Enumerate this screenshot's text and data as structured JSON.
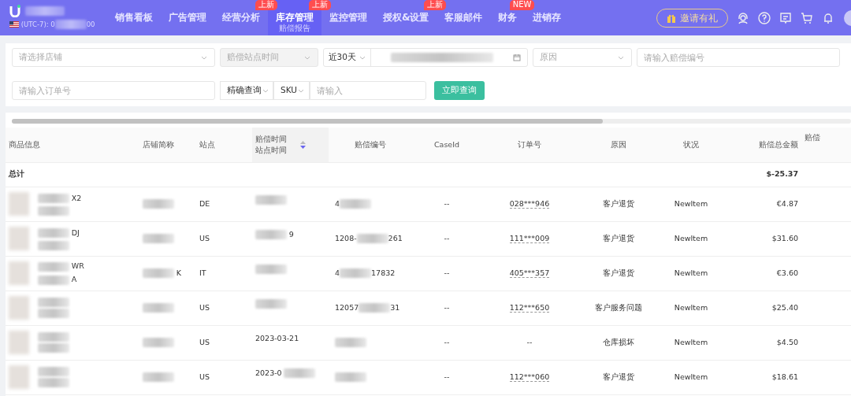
{
  "header": {
    "timezone": [
      {
        "text": "(UTC-7): 0"
      },
      {
        "redacted": true
      },
      {
        "text": "00"
      }
    ],
    "nav": [
      {
        "label": "销售看板",
        "selected": false
      },
      {
        "label": "广告管理",
        "selected": false
      },
      {
        "label": "经营分析",
        "selected": false,
        "badge": "上新"
      },
      {
        "label": "库存管理",
        "selected": true,
        "badge": "上新",
        "sub": "赔偿报告"
      },
      {
        "label": "监控管理",
        "selected": false
      },
      {
        "label": "授权&设置",
        "selected": false,
        "badge": "上新"
      },
      {
        "label": "客服邮件",
        "selected": false
      },
      {
        "label": "财务",
        "selected": false,
        "badge": "NEW"
      },
      {
        "label": "进销存",
        "selected": false
      }
    ],
    "invite_button": "邀请有礼"
  },
  "filters": [
    [
      {
        "kind": "select",
        "placeholder": "请选择店铺",
        "disabled": false
      },
      {
        "kind": "select",
        "placeholder": "赔偿站点时间",
        "disabled": true
      },
      {
        "kind": "range",
        "value": "近30天",
        "disabled": false
      },
      {
        "kind": "select",
        "placeholder": "原因",
        "disabled": false
      },
      {
        "kind": "input",
        "placeholder": "请输入赔偿编号",
        "disabled": false
      }
    ],
    [
      {
        "kind": "input",
        "placeholder": "请输入订单号",
        "disabled": false
      },
      {
        "kind": "select",
        "value": "精确查询",
        "disabled": false
      },
      {
        "kind": "select",
        "value": "SKU",
        "disabled": false
      },
      {
        "kind": "input",
        "placeholder": "请输入",
        "disabled": false
      },
      {
        "kind": "button",
        "label": "立即查询",
        "disabled": false
      }
    ]
  ],
  "table": {
    "columns": [
      {
        "lines": [
          "商品信息"
        ],
        "sortable": false
      },
      {
        "lines": [
          "店铺简称"
        ],
        "sortable": false
      },
      {
        "lines": [
          "站点"
        ],
        "sortable": false
      },
      {
        "lines": [
          "赔偿时间",
          "站点时间"
        ],
        "sortable": true
      },
      {
        "lines": [
          "赔偿编号"
        ],
        "sortable": false
      },
      {
        "lines": [
          "CaseId"
        ],
        "sortable": false
      },
      {
        "lines": [
          "订单号"
        ],
        "sortable": false
      },
      {
        "lines": [
          "原因"
        ],
        "sortable": false
      },
      {
        "lines": [
          "状况"
        ],
        "sortable": false
      },
      {
        "lines": [
          "赔偿总金额"
        ],
        "sortable": false
      },
      {
        "lines": [
          "赔偿"
        ],
        "sortable": false
      }
    ],
    "total": {
      "label": "总计",
      "amount": "$-25.37"
    },
    "rows": [
      {
        "product": [
          [
            {
              "redacted": true
            },
            {
              "text": "X2"
            }
          ],
          [
            {
              "redacted": true
            }
          ]
        ],
        "shop": [
          {
            "redacted": true
          }
        ],
        "site": "DE",
        "date": [
          {
            "redacted": true
          }
        ],
        "claim": [
          {
            "text": "4"
          },
          {
            "redacted": true
          }
        ],
        "case_id": "--",
        "order": "028***946",
        "order_linked": true,
        "reason": "客户退货",
        "status": "NewItem",
        "amount": "€4.87"
      },
      {
        "product": [
          [
            {
              "redacted": true
            },
            {
              "text": "DJ"
            }
          ],
          [
            {
              "redacted": true
            }
          ]
        ],
        "shop": [
          {
            "redacted": true
          }
        ],
        "site": "US",
        "date": [
          {
            "redacted": true
          },
          {
            "text": "9"
          }
        ],
        "claim": [
          {
            "text": "1208-"
          },
          {
            "redacted": true
          },
          {
            "text": "261"
          }
        ],
        "case_id": "--",
        "order": "111***009",
        "order_linked": true,
        "reason": "客户退货",
        "status": "NewItem",
        "amount": "$31.60"
      },
      {
        "product": [
          [
            {
              "redacted": true
            },
            {
              "text": "WR"
            }
          ],
          [
            {
              "redacted": true
            },
            {
              "text": "A"
            }
          ]
        ],
        "shop": [
          {
            "redacted": true
          },
          {
            "text": "K"
          }
        ],
        "site": "IT",
        "date": [
          {
            "redacted": true
          }
        ],
        "claim": [
          {
            "text": "4"
          },
          {
            "redacted": true
          },
          {
            "text": "17832"
          }
        ],
        "case_id": "--",
        "order": "405***357",
        "order_linked": true,
        "reason": "客户退货",
        "status": "NewItem",
        "amount": "€3.60"
      },
      {
        "product": [
          [
            {
              "redacted": true
            }
          ],
          [
            {
              "redacted": true
            }
          ]
        ],
        "shop": [
          {
            "redacted": true
          }
        ],
        "site": "US",
        "date": [
          {
            "redacted": true
          }
        ],
        "claim": [
          {
            "text": "12057"
          },
          {
            "redacted": true
          },
          {
            "text": "31"
          }
        ],
        "case_id": "--",
        "order": "112***650",
        "order_linked": true,
        "reason": "客户服务问题",
        "status": "NewItem",
        "amount": "$25.40"
      },
      {
        "product": [
          [
            {
              "redacted": true
            }
          ],
          [
            {
              "redacted": true
            }
          ]
        ],
        "shop": [
          {
            "redacted": true
          }
        ],
        "site": "US",
        "date": [
          {
            "text": "2023-03-21"
          }
        ],
        "claim": [
          {
            "redacted": true
          }
        ],
        "case_id": "--",
        "order": "--",
        "order_linked": false,
        "reason": "仓库损坏",
        "status": "NewItem",
        "amount": "$4.50"
      },
      {
        "product": [
          [
            {
              "redacted": true
            }
          ],
          [
            {
              "redacted": true
            }
          ]
        ],
        "shop": [
          {
            "redacted": true
          }
        ],
        "site": "US",
        "date": [
          {
            "text": "2023-0"
          },
          {
            "redacted": true
          }
        ],
        "claim": [
          {
            "redacted": true
          }
        ],
        "case_id": "--",
        "order": "112***060",
        "order_linked": true,
        "reason": "客户退货",
        "status": "NewItem",
        "amount": "$18.61"
      }
    ]
  }
}
